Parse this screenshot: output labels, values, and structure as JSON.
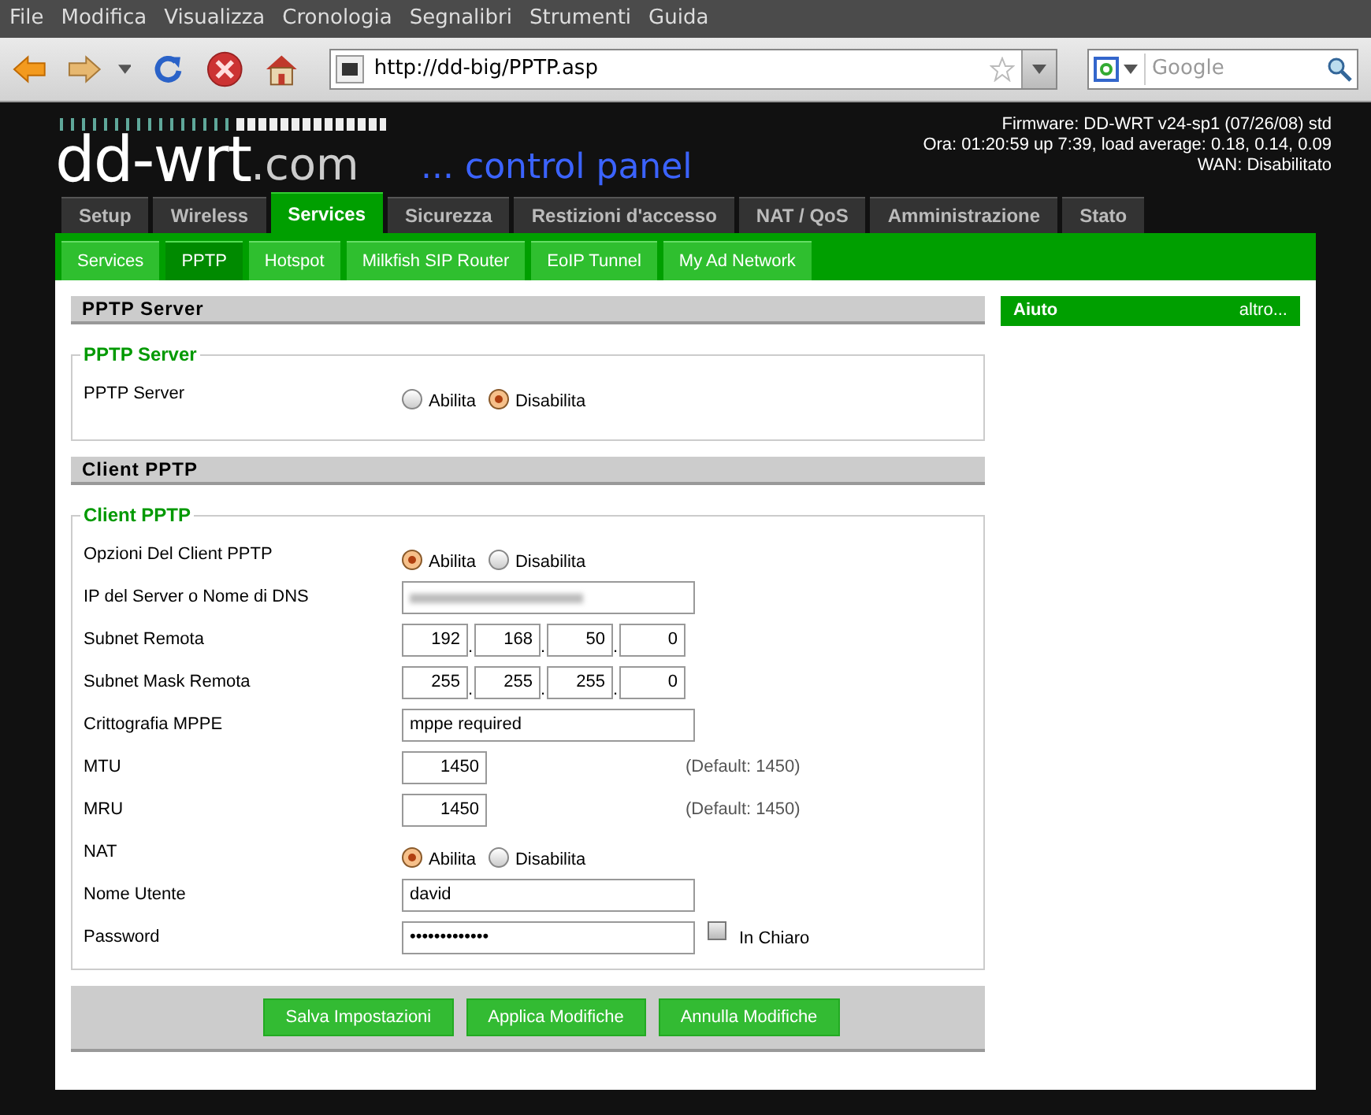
{
  "menu": [
    "File",
    "Modifica",
    "Visualizza",
    "Cronologia",
    "Segnalibri",
    "Strumenti",
    "Guida"
  ],
  "toolbar": {
    "url": "http://dd-big/PPTP.asp",
    "search": {
      "placeholder": "Google"
    }
  },
  "header": {
    "logo": "dd-wrt",
    "logo_suffix": ".com",
    "subtitle": "... control panel",
    "info": [
      "Firmware: DD-WRT v24-sp1 (07/26/08) std",
      "Ora: 01:20:59 up 7:39, load average: 0.18, 0.14, 0.09",
      "WAN: Disabilitato"
    ]
  },
  "tabs": [
    {
      "label": "Setup",
      "selected": false
    },
    {
      "label": "Wireless",
      "selected": false
    },
    {
      "label": "Services",
      "selected": true
    },
    {
      "label": "Sicurezza",
      "selected": false
    },
    {
      "label": "Restizioni d'accesso",
      "selected": false
    },
    {
      "label": "NAT / QoS",
      "selected": false
    },
    {
      "label": "Amministrazione",
      "selected": false
    },
    {
      "label": "Stato",
      "selected": false
    }
  ],
  "subtabs": [
    {
      "label": "Services",
      "selected": false
    },
    {
      "label": "PPTP",
      "selected": true
    },
    {
      "label": "Hotspot",
      "selected": false
    },
    {
      "label": "Milkfish SIP Router",
      "selected": false
    },
    {
      "label": "EoIP Tunnel",
      "selected": false
    },
    {
      "label": "My Ad Network",
      "selected": false
    }
  ],
  "sections": [
    {
      "title": "PPTP Server",
      "legend": "PPTP Server",
      "rows": [
        {
          "kind": "radio",
          "label": "PPTP Server",
          "options": [
            {
              "label": "Abilita",
              "selected": false
            },
            {
              "label": "Disabilita",
              "selected": true
            }
          ]
        }
      ]
    },
    {
      "title": "Client PPTP",
      "legend": "Client PPTP",
      "rows": [
        {
          "kind": "radio",
          "label": "Opzioni Del Client PPTP",
          "options": [
            {
              "label": "Abilita",
              "selected": true
            },
            {
              "label": "Disabilita",
              "selected": false
            }
          ]
        },
        {
          "kind": "blurred",
          "label": "IP del Server o Nome di DNS"
        },
        {
          "kind": "ip",
          "label": "Subnet Remota",
          "octets": [
            "192",
            "168",
            "50",
            "0"
          ],
          "separator": "."
        },
        {
          "kind": "ip",
          "label": "Subnet Mask Remota",
          "octets": [
            "255",
            "255",
            "255",
            "0"
          ],
          "separator": "."
        },
        {
          "kind": "text",
          "label": "Crittografia MPPE",
          "value": "mppe required"
        },
        {
          "kind": "number",
          "label": "MTU",
          "value": "1450",
          "hint": "(Default: 1450)"
        },
        {
          "kind": "number",
          "label": "MRU",
          "value": "1450",
          "hint": "(Default: 1450)"
        },
        {
          "kind": "radio",
          "label": "NAT",
          "options": [
            {
              "label": "Abilita",
              "selected": true
            },
            {
              "label": "Disabilita",
              "selected": false
            }
          ]
        },
        {
          "kind": "text",
          "label": "Nome Utente",
          "value": "david"
        },
        {
          "kind": "password",
          "label": "Password",
          "value": "•••••••••••••",
          "checkbox": {
            "label": "In Chiaro",
            "checked": false
          }
        }
      ]
    }
  ],
  "buttons": [
    "Salva Impostazioni",
    "Applica Modifiche",
    "Annulla Modifiche"
  ],
  "help": {
    "title": "Aiuto",
    "link": "altro..."
  }
}
